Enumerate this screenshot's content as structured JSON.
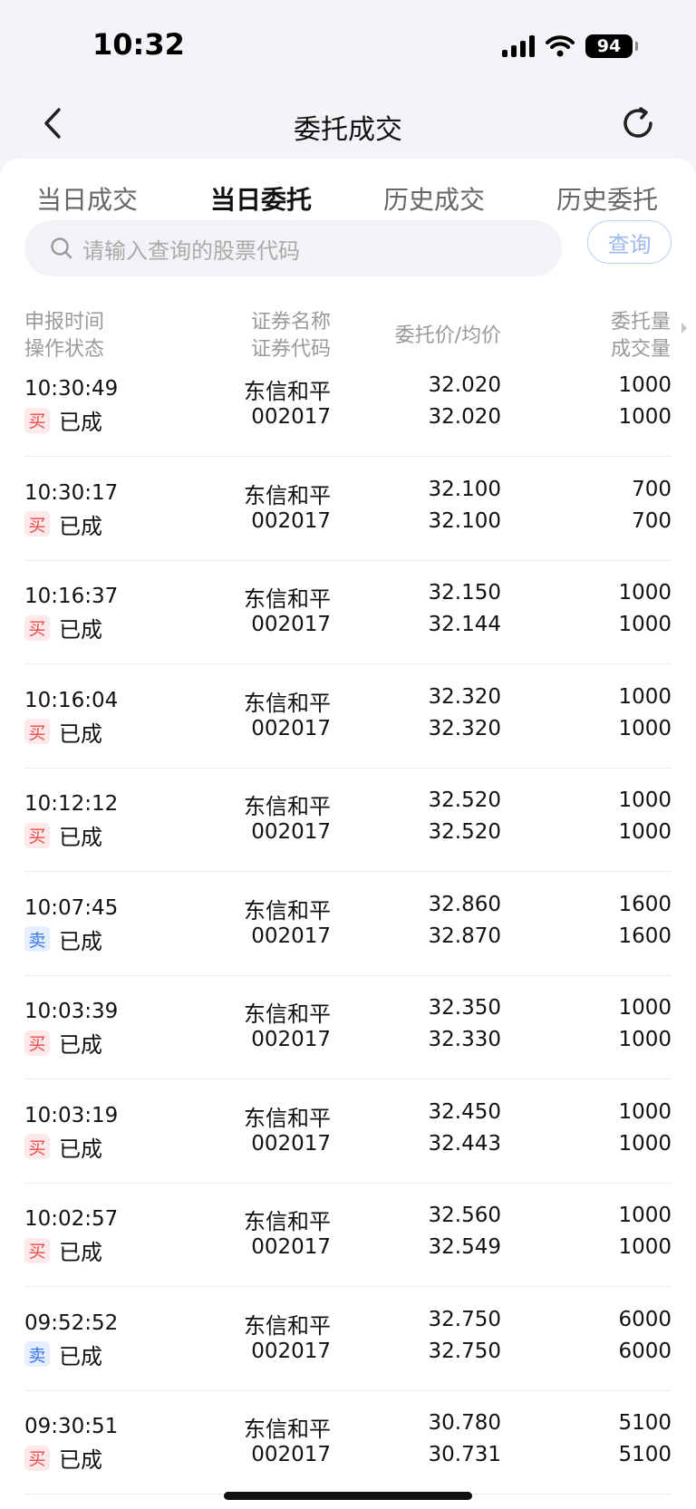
{
  "status_bar": {
    "time": "10:32",
    "battery": "94"
  },
  "nav": {
    "title": "委托成交"
  },
  "tabs": [
    {
      "label": "当日成交",
      "active": false
    },
    {
      "label": "当日委托",
      "active": true
    },
    {
      "label": "历史成交",
      "active": false
    },
    {
      "label": "历史委托",
      "active": false
    }
  ],
  "search": {
    "placeholder": "请输入查询的股票代码",
    "button": "查询"
  },
  "headers": {
    "time": "申报时间",
    "status": "操作状态",
    "name": "证券名称",
    "code": "证券代码",
    "price": "委托价/均价",
    "qty": "委托量",
    "filled": "成交量"
  },
  "rows": [
    {
      "time": "10:30:49",
      "side": "买",
      "side_type": "buy",
      "status": "已成",
      "name": "东信和平",
      "code": "002017",
      "price": "32.020",
      "avg": "32.020",
      "qty": "1000",
      "filled": "1000"
    },
    {
      "time": "10:30:17",
      "side": "买",
      "side_type": "buy",
      "status": "已成",
      "name": "东信和平",
      "code": "002017",
      "price": "32.100",
      "avg": "32.100",
      "qty": "700",
      "filled": "700"
    },
    {
      "time": "10:16:37",
      "side": "买",
      "side_type": "buy",
      "status": "已成",
      "name": "东信和平",
      "code": "002017",
      "price": "32.150",
      "avg": "32.144",
      "qty": "1000",
      "filled": "1000"
    },
    {
      "time": "10:16:04",
      "side": "买",
      "side_type": "buy",
      "status": "已成",
      "name": "东信和平",
      "code": "002017",
      "price": "32.320",
      "avg": "32.320",
      "qty": "1000",
      "filled": "1000"
    },
    {
      "time": "10:12:12",
      "side": "买",
      "side_type": "buy",
      "status": "已成",
      "name": "东信和平",
      "code": "002017",
      "price": "32.520",
      "avg": "32.520",
      "qty": "1000",
      "filled": "1000"
    },
    {
      "time": "10:07:45",
      "side": "卖",
      "side_type": "sell",
      "status": "已成",
      "name": "东信和平",
      "code": "002017",
      "price": "32.860",
      "avg": "32.870",
      "qty": "1600",
      "filled": "1600"
    },
    {
      "time": "10:03:39",
      "side": "买",
      "side_type": "buy",
      "status": "已成",
      "name": "东信和平",
      "code": "002017",
      "price": "32.350",
      "avg": "32.330",
      "qty": "1000",
      "filled": "1000"
    },
    {
      "time": "10:03:19",
      "side": "买",
      "side_type": "buy",
      "status": "已成",
      "name": "东信和平",
      "code": "002017",
      "price": "32.450",
      "avg": "32.443",
      "qty": "1000",
      "filled": "1000"
    },
    {
      "time": "10:02:57",
      "side": "买",
      "side_type": "buy",
      "status": "已成",
      "name": "东信和平",
      "code": "002017",
      "price": "32.560",
      "avg": "32.549",
      "qty": "1000",
      "filled": "1000"
    },
    {
      "time": "09:52:52",
      "side": "卖",
      "side_type": "sell",
      "status": "已成",
      "name": "东信和平",
      "code": "002017",
      "price": "32.750",
      "avg": "32.750",
      "qty": "6000",
      "filled": "6000"
    },
    {
      "time": "09:30:51",
      "side": "买",
      "side_type": "buy",
      "status": "已成",
      "name": "东信和平",
      "code": "002017",
      "price": "30.780",
      "avg": "30.731",
      "qty": "5100",
      "filled": "5100"
    }
  ],
  "colors": {
    "buy": "#e94a4a",
    "sell": "#3a76e8",
    "accent": "#2f6bff"
  },
  "icons": [
    "back-icon",
    "refresh-icon",
    "search-icon",
    "more-columns-icon",
    "signal-icon",
    "wifi-icon",
    "battery-icon"
  ]
}
